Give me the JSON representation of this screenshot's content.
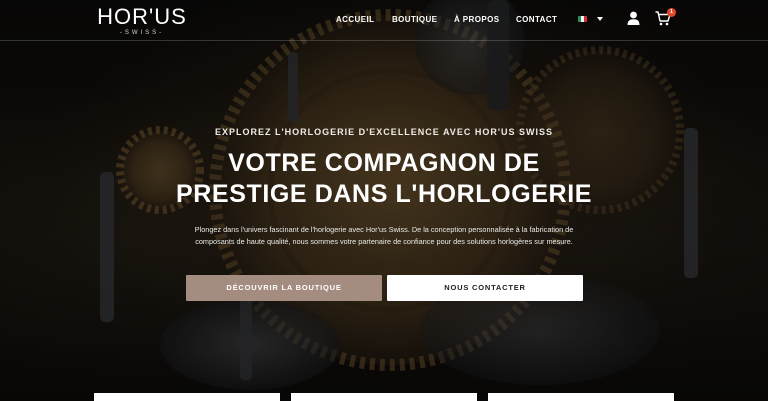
{
  "brand": {
    "name": "HOR'US",
    "tagline": "-SWISS-"
  },
  "nav": {
    "items": [
      {
        "label": "ACCUEIL"
      },
      {
        "label": "BOUTIQUE"
      },
      {
        "label": "À PROPOS"
      },
      {
        "label": "CONTACT"
      }
    ],
    "language": "italian-flag",
    "cart_count": "1"
  },
  "hero": {
    "eyebrow": "EXPLOREZ L'HORLOGERIE D'EXCELLENCE AVEC HOR'US SWISS",
    "headline_line1": "VOTRE COMPAGNON DE",
    "headline_line2": "PRESTIGE DANS L'HORLOGERIE",
    "description": "Plongez dans l'univers fascinant de l'horlogerie avec Hor'us Swiss. De la conception personnalisée à la fabrication de composants de haute qualité, nous sommes votre partenaire de confiance pour des solutions horlogères sur mesure.",
    "primary_button": "DÉCOUVRIR LA BOUTIQUE",
    "secondary_button": "NOUS CONTACTER"
  },
  "colors": {
    "primary_button_bg": "#a48c80",
    "badge": "#e0492c",
    "flag_green": "#2e8b57",
    "flag_white": "#f4f4f4",
    "flag_red": "#cf2b37"
  }
}
